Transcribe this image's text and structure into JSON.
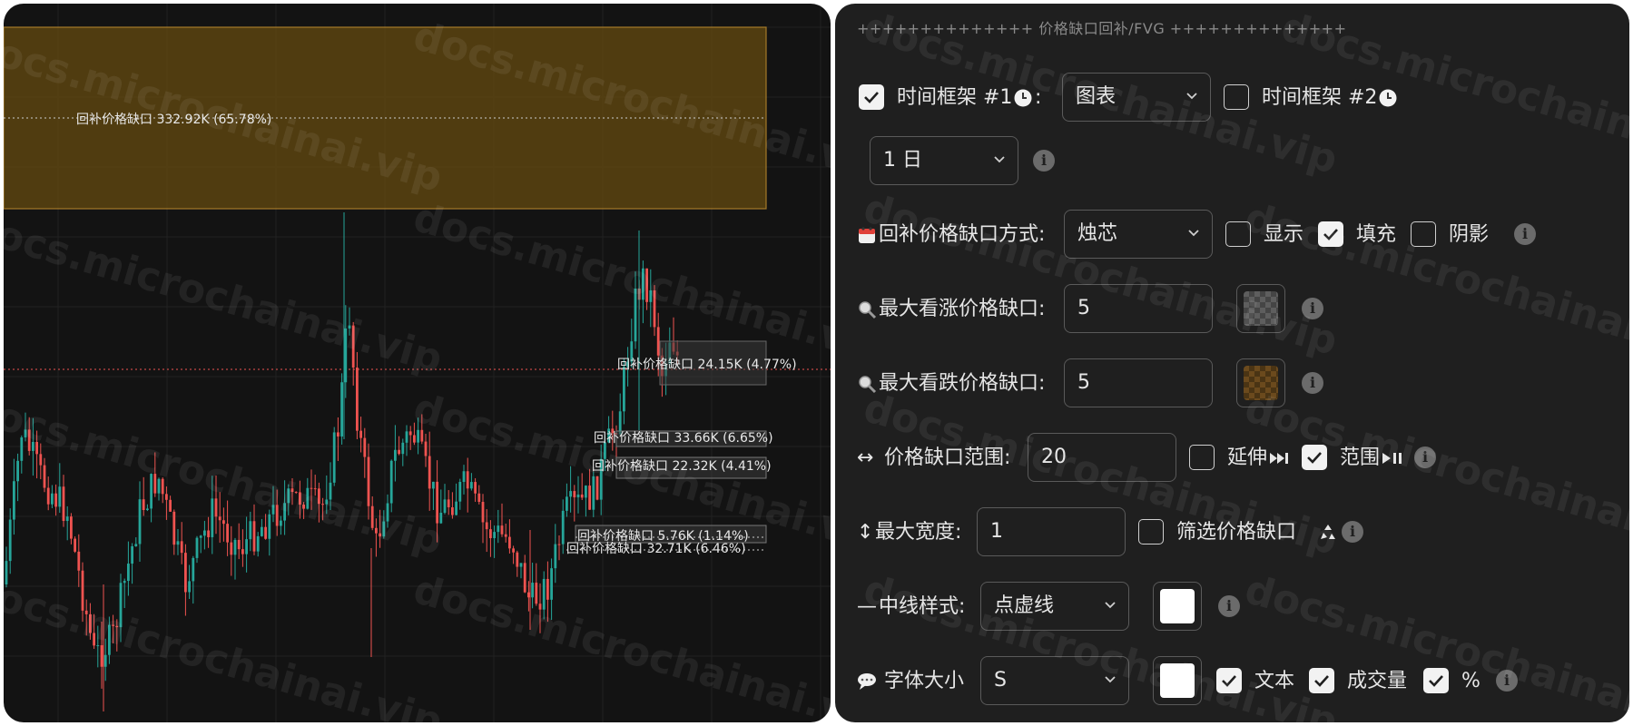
{
  "watermark": "docs.microchainai.vip",
  "chart": {
    "gaps": [
      {
        "label": "回补价格缺口 332.92K (65.78%)"
      },
      {
        "label": "回补价格缺口 24.15K (4.77%)"
      },
      {
        "label": "回补价格缺口 33.66K (6.65%)"
      },
      {
        "label": "回补价格缺口 22.32K (4.41%)"
      },
      {
        "label": "回补价格缺口 5.76K (1.14%)"
      },
      {
        "label": "回补价格缺口 32.71K (6.46%)"
      }
    ],
    "colors": {
      "up": "#26a69a",
      "down": "#ef5350",
      "gap_fill": "#5c4411",
      "gap_border": "#a57a2a",
      "gap_box": "#3a3a3a"
    }
  },
  "settings": {
    "header": "++++++++++++++ 价格缺口回补/FVG ++++++++++++++",
    "timeframe1": {
      "label": "时间框架 #1",
      "icon": "clock-icon",
      "colon": ":",
      "value": "图表",
      "checked": true
    },
    "timeframe2": {
      "label": "时间框架 #2",
      "icon": "clock-icon",
      "value": "1 日",
      "checked": false
    },
    "fill_method": {
      "label": "回补价格缺口方式:",
      "icon": "calendar-icon",
      "value": "烛芯",
      "show": "显示",
      "fill": "填充",
      "shadow": "阴影",
      "show_checked": false,
      "fill_checked": true,
      "shadow_checked": false
    },
    "max_bull": {
      "label": "最大看涨价格缺口:",
      "icon": "magnifier-icon",
      "value": "5"
    },
    "max_bear": {
      "label": "最大看跌价格缺口:",
      "icon": "magnifier-icon",
      "value": "5"
    },
    "gap_range": {
      "label": "价格缺口范围:",
      "icon": "left-right-arrow-icon",
      "value": "20",
      "extend": "延伸",
      "range": "范围",
      "extend_checked": false,
      "range_checked": true
    },
    "max_width": {
      "label": "最大宽度:",
      "icon": "up-down-arrow-icon",
      "value": "1",
      "filter": "筛选价格缺口",
      "filter_checked": false
    },
    "midline": {
      "label": "中线样式:",
      "icon": "dash-line-icon",
      "value": "点虚线"
    },
    "font_size": {
      "label": "字体大小",
      "icon": "speech-bubble-icon",
      "value": "S",
      "text": "文本",
      "volume": "成交量",
      "percent": "%",
      "text_checked": true,
      "volume_checked": true,
      "percent_checked": true
    }
  }
}
